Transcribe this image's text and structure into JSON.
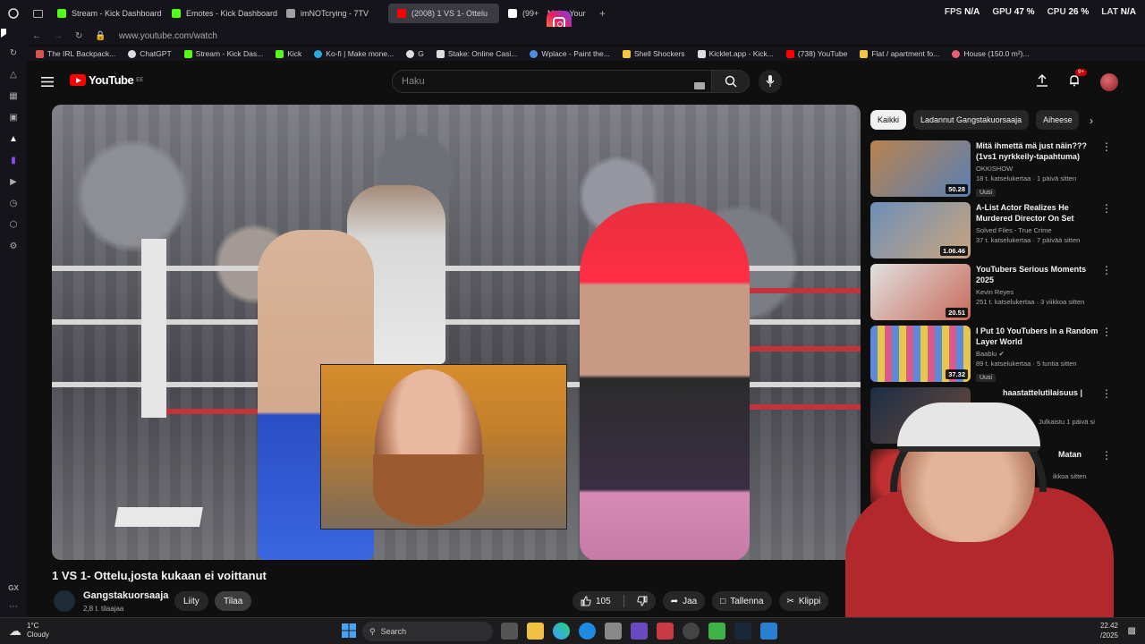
{
  "browser": {
    "tabs": [
      {
        "label": "Stream - Kick Dashboard",
        "color": "#53fc18"
      },
      {
        "label": "Emotes - Kick Dashboard",
        "color": "#53fc18"
      },
      {
        "label": "imNOTcrying - 7TV",
        "color": "#a0a0a0"
      },
      {
        "label": "(2008) 1 VS 1- Ottelu",
        "color": "#ff0000"
      },
      {
        "label": "(99+",
        "color": "#ffffff"
      },
      {
        "label": "Make Your",
        "color": "#ffffff"
      }
    ],
    "stats": {
      "fps_label": "FPS",
      "fps_value": "N/A",
      "gpu_label": "GPU",
      "gpu_value": "47 %",
      "cpu_label": "CPU",
      "cpu_value": "26 %",
      "lat_label": "LAT",
      "lat_value": "N/A"
    },
    "url": "www.youtube.com/watch",
    "bookmarks": [
      {
        "label": "The IRL Backpack...",
        "color": "#d9534f"
      },
      {
        "label": "ChatGPT",
        "color": "#dddddd"
      },
      {
        "label": "Stream - Kick Das...",
        "color": "#53fc18"
      },
      {
        "label": "Kick",
        "color": "#53fc18"
      },
      {
        "label": "Ko-fi | Make mone...",
        "color": "#29abe0"
      },
      {
        "label": "G",
        "color": "#dddddd"
      },
      {
        "label": "Stake: Online Casi...",
        "color": "#dddddd"
      },
      {
        "label": "Wplace - Paint the...",
        "color": "#4a90e2"
      },
      {
        "label": "Shell Shockers",
        "color": "#f5c542"
      },
      {
        "label": "Kicklet.app - Kick...",
        "color": "#dddddd"
      },
      {
        "label": "(738) YouTube",
        "color": "#ff0000"
      },
      {
        "label": "Flat / apartment fo...",
        "color": "#f5c542"
      },
      {
        "label": "House (150.0 m²)...",
        "color": "#e85d75"
      }
    ]
  },
  "youtube": {
    "logo_text": "YouTube",
    "logo_region": "EE",
    "search_placeholder": "Haku",
    "notification_count": "9+",
    "video_title": "1 VS 1- Ottelu,josta kukaan ei voittanut",
    "channel_name": "Gangstakuorsaaja",
    "channel_subs": "2,8 t. tilaajaa",
    "join_label": "Liity",
    "subscribe_label": "Tilaa",
    "likes": "105",
    "share_label": "Jaa",
    "save_label": "Tallenna",
    "clip_label": "Klippi",
    "chips": [
      "Kaikki",
      "Ladannut Gangstakuorsaaja",
      "Aiheese"
    ],
    "related": [
      {
        "title": "Mitä ihmettä mä just näin??? (1vs1 nyrkkeily-tapahtuma)",
        "channel": "OKKISHOW",
        "meta": "18 t. katselukertaa · 1 päivä sitten",
        "duration": "50.28",
        "badge": "Uusi",
        "thumb": "#9b6d4a"
      },
      {
        "title": "A-List Actor Realizes He Murdered Director On Set",
        "channel": "Solved Files - True Crime",
        "meta": "37 t. katselukertaa · 7 päivää sitten",
        "duration": "1.06.46",
        "badge": "",
        "thumb": "#6e8fb8"
      },
      {
        "title": "YouTubers Serious Moments 2025",
        "channel": "Kevin Reyes",
        "meta": "251 t. katselukertaa · 3 viikkoa sitten",
        "duration": "20.51",
        "badge": "",
        "thumb": "#c96b5a"
      },
      {
        "title": "I Put 10 YouTubers in a Random Layer World",
        "channel": "Baablu",
        "meta": "89 t. katselukertaa · 5 tuntia sitten",
        "duration": "37.32",
        "badge": "Uusi",
        "thumb": "#5b8bd8"
      },
      {
        "title": "haastattelutilaisuus |",
        "channel": "",
        "meta": "Julkaistu 1 päivä si",
        "duration": "",
        "badge": "",
        "thumb": "#3d4f6b"
      },
      {
        "title": "Matan",
        "channel": "",
        "meta": "ikkoa sitten",
        "duration": "",
        "badge": "",
        "thumb": "#8a2a2a"
      }
    ]
  },
  "taskbar": {
    "weather_temp": "1°C",
    "weather_desc": "Cloudy",
    "search_label": "Search",
    "time": "22.42",
    "date": "/2025"
  },
  "sidebar": {
    "gx_label": "GX"
  }
}
